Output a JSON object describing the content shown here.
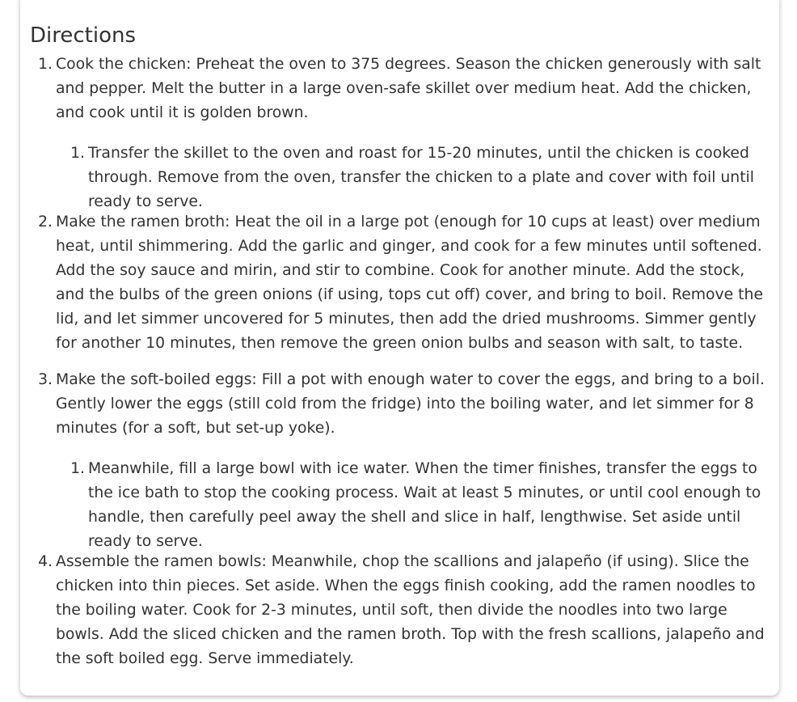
{
  "section": {
    "title": "Directions"
  },
  "steps": [
    {
      "number": "1.",
      "text": "Cook the chicken: Preheat the oven to 375 degrees. Season the chicken generously with salt and pepper. Melt the butter in a large oven-safe skillet over medium heat. Add the chicken, and cook until it is golden brown.",
      "substeps": [
        {
          "number": "1.",
          "text": "Transfer the skillet to the oven and roast for 15-20 minutes, until the chicken is cooked through. Remove from the oven, transfer the chicken to a plate and cover with foil until ready to serve."
        }
      ]
    },
    {
      "number": "2.",
      "text": "Make the ramen broth: Heat the oil in a large pot (enough for 10 cups at least) over medium heat, until shimmering. Add the garlic and ginger, and cook for a few minutes until softened. Add the soy sauce and mirin, and stir to combine. Cook for another minute. Add the stock, and the bulbs of the green onions (if using, tops cut off) cover, and bring to boil. Remove the lid, and let simmer uncovered for 5 minutes, then add the dried mushrooms. Simmer gently for another 10 minutes, then remove the green onion bulbs and season with salt, to taste.",
      "substeps": []
    },
    {
      "number": "3.",
      "text": "Make the soft-boiled eggs: Fill a pot with enough water to cover the eggs, and bring to a boil. Gently lower the eggs (still cold from the fridge) into the boiling water, and let simmer for 8 minutes (for a soft, but set-up yoke).",
      "substeps": [
        {
          "number": "1.",
          "text": "Meanwhile, fill a large bowl with ice water. When the timer finishes, transfer the eggs to the ice bath to stop the cooking process. Wait at least 5 minutes, or until cool enough to handle, then carefully peel away the shell and slice in half, lengthwise. Set aside until ready to serve."
        }
      ]
    },
    {
      "number": "4.",
      "text": "Assemble the ramen bowls: Meanwhile, chop the scallions and jalapeño (if using). Slice the chicken into thin pieces. Set aside. When the eggs finish cooking, add the ramen noodles to the boiling water. Cook for 2-3 minutes, until soft, then divide the noodles into two large bowls. Add the sliced chicken and the ramen broth. Top with the fresh scallions, jalapeño and the soft boiled egg. Serve immediately.",
      "substeps": []
    }
  ]
}
